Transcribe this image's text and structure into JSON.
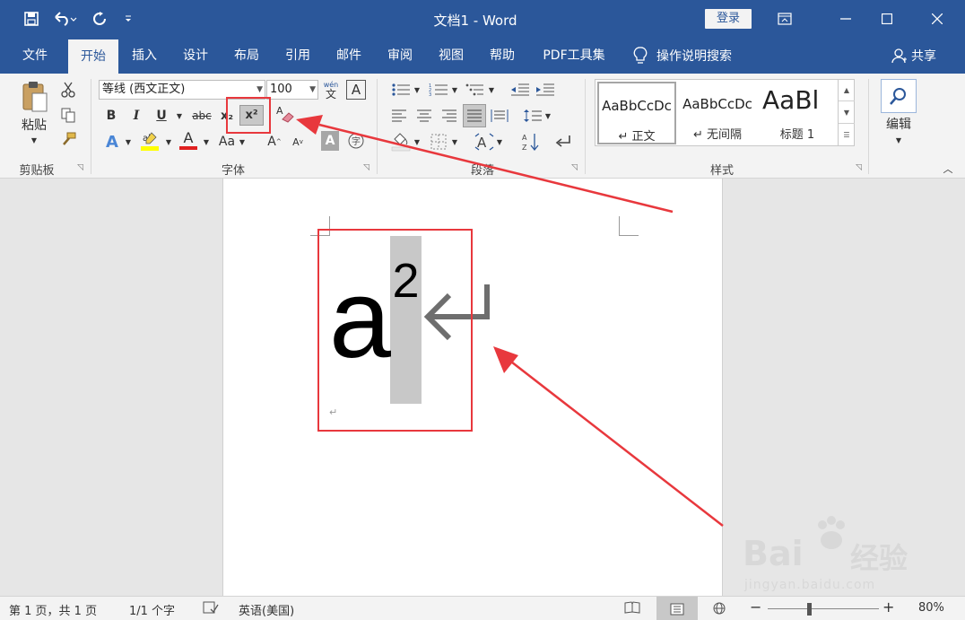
{
  "titlebar": {
    "doc_title": "文档1  -  Word",
    "login": "登录",
    "qat": {
      "save_icon": "save-icon",
      "undo_icon": "undo-icon",
      "redo_icon": "redo-icon",
      "customize_icon": "customize-qat-icon"
    }
  },
  "tabs": [
    "文件",
    "开始",
    "插入",
    "设计",
    "布局",
    "引用",
    "邮件",
    "审阅",
    "视图",
    "帮助",
    "PDF工具集"
  ],
  "active_tab": "开始",
  "tell_me": "操作说明搜索",
  "share": "共享",
  "clipboard": {
    "paste_label": "粘贴",
    "group_label": "剪贴板"
  },
  "font": {
    "name": "等线 (西文正文)",
    "size": "100",
    "group_label": "字体",
    "bold": "B",
    "italic": "I",
    "underline": "U",
    "strike": "abc",
    "subscript": "x₂",
    "superscript": "x²",
    "text_effects": "A",
    "font_color": "A",
    "change_case": "Aa",
    "grow": "A",
    "shrink": "A",
    "char_shading": "A"
  },
  "paragraph": {
    "group_label": "段落"
  },
  "styles": {
    "group_label": "样式",
    "items": [
      {
        "sample": "AaBbCcDc",
        "name": "↵ 正文"
      },
      {
        "sample": "AaBbCcDc",
        "name": "↵ 无间隔"
      },
      {
        "sample": "AaBl",
        "name": "标题 1"
      }
    ]
  },
  "editing": {
    "label": "编辑"
  },
  "document": {
    "base_char": "a",
    "superscript_char": "2",
    "paragraph_mark": "↵",
    "empty_paragraph_mark": "↵"
  },
  "status": {
    "page": "第 1 页，共 1 页",
    "words": "1/1 个字",
    "language": "英语(美国)",
    "zoom": "80%"
  },
  "colors": {
    "ribbon_blue": "#2b579a",
    "annotation_red": "#e8383d",
    "selection_gray": "#c8c8c8"
  },
  "watermark": {
    "brand": "Bai",
    "brand2": "经验",
    "url": "jingyan.baidu.com"
  }
}
